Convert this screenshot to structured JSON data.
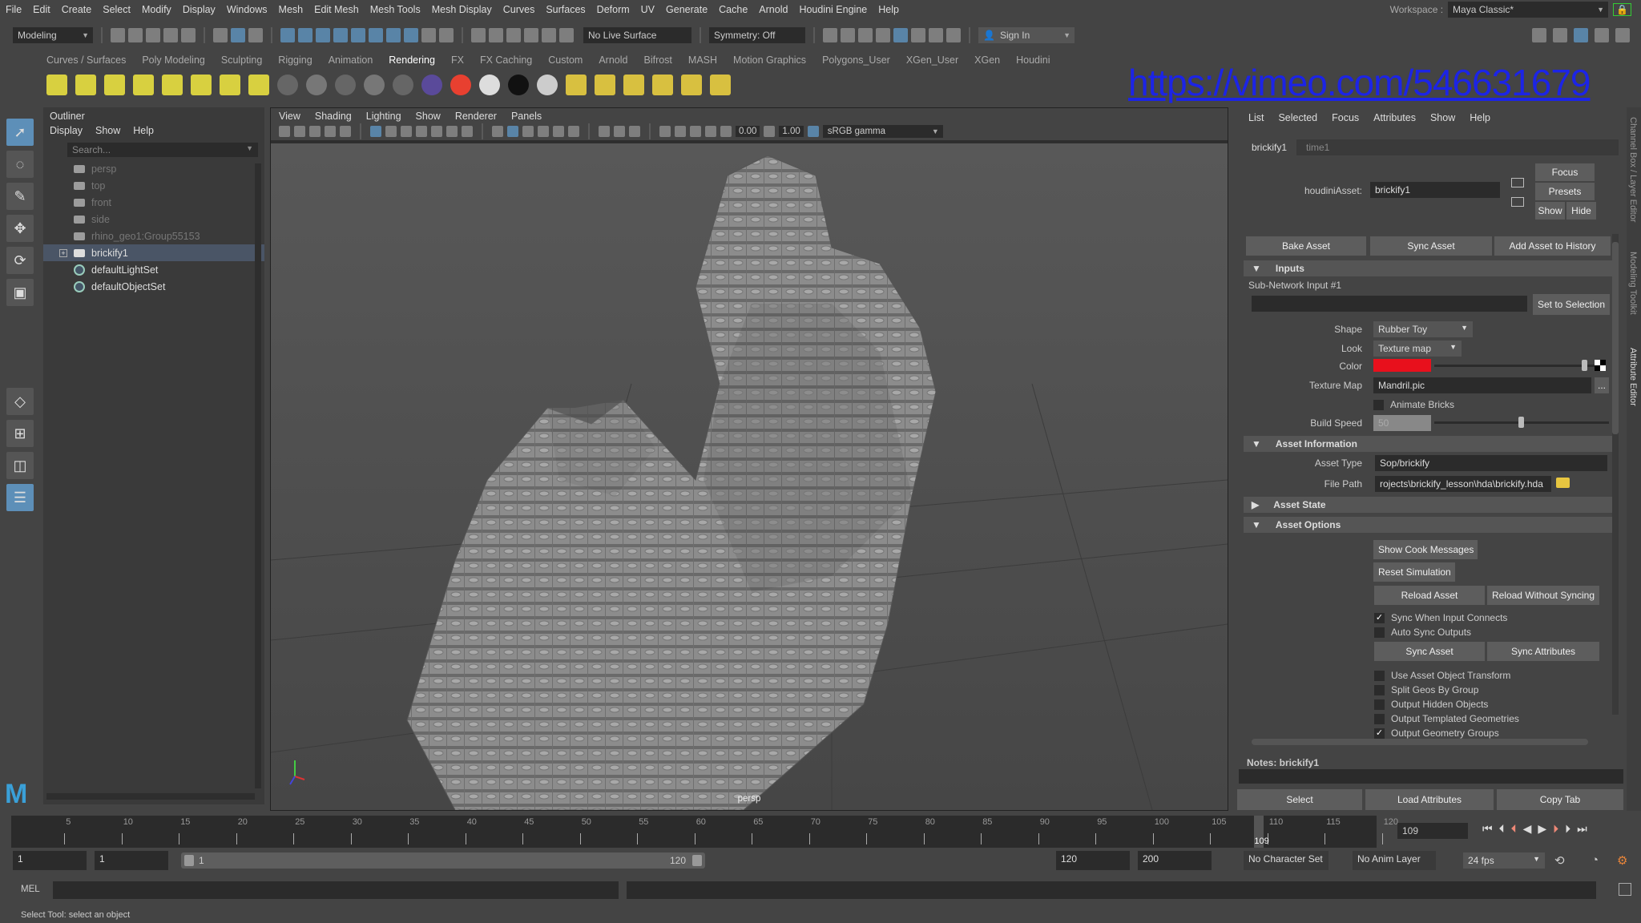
{
  "menubar": {
    "items": [
      "File",
      "Edit",
      "Create",
      "Select",
      "Modify",
      "Display",
      "Windows",
      "Mesh",
      "Edit Mesh",
      "Mesh Tools",
      "Mesh Display",
      "Curves",
      "Surfaces",
      "Deform",
      "UV",
      "Generate",
      "Cache",
      "Arnold",
      "Houdini Engine",
      "Help"
    ],
    "workspace_label": "Workspace :",
    "workspace_value": "Maya Classic*"
  },
  "statusline": {
    "mode": "Modeling",
    "live_surface": "No Live Surface",
    "symmetry": "Symmetry: Off",
    "sign_in": "Sign In"
  },
  "shelf": {
    "tabs": [
      "Curves / Surfaces",
      "Poly Modeling",
      "Sculpting",
      "Rigging",
      "Animation",
      "Rendering",
      "FX",
      "FX Caching",
      "Custom",
      "Arnold",
      "Bifrost",
      "MASH",
      "Motion Graphics",
      "Polygons_User",
      "XGen_User",
      "XGen",
      "Houdini"
    ],
    "active_tab": "Rendering",
    "icons": [
      "ambient-light",
      "directional-light",
      "point-light",
      "spot-light",
      "area-light",
      "volume-light",
      "camera-aim",
      "camera-aim-up",
      "blinn-sphere",
      "lambert-sphere",
      "phong-sphere",
      "phonge-sphere",
      "anisotropic-sphere",
      "layered-texture",
      "ramp-texture",
      "white-sphere",
      "black-sphere",
      "outline-sphere",
      "hypershade",
      "render-settings",
      "render-view",
      "ipr",
      "render-sequence",
      "render-setup"
    ]
  },
  "overlay_link": "https://vimeo.com/546631679",
  "outliner": {
    "title": "Outliner",
    "menus": [
      "Display",
      "Show",
      "Help"
    ],
    "search_placeholder": "Search...",
    "items": [
      {
        "label": "persp",
        "icon": "camera",
        "dim": true
      },
      {
        "label": "top",
        "icon": "camera",
        "dim": true
      },
      {
        "label": "front",
        "icon": "camera",
        "dim": true
      },
      {
        "label": "side",
        "icon": "camera",
        "dim": true
      },
      {
        "label": "rhino_geo1:Group55153",
        "icon": "group",
        "dim": true
      },
      {
        "label": "brickify1",
        "icon": "houdini-asset",
        "selected": true
      },
      {
        "label": "defaultLightSet",
        "icon": "set"
      },
      {
        "label": "defaultObjectSet",
        "icon": "set"
      }
    ]
  },
  "viewport": {
    "menus": [
      "View",
      "Shading",
      "Lighting",
      "Show",
      "Renderer",
      "Panels"
    ],
    "exposure": "0.00",
    "gamma": "1.00",
    "color_space": "sRGB gamma",
    "camera": "persp"
  },
  "attr_editor": {
    "menus": [
      "List",
      "Selected",
      "Focus",
      "Attributes",
      "Show",
      "Help"
    ],
    "tabs": [
      "brickify1",
      "time1"
    ],
    "asset_label": "houdiniAsset:",
    "asset_value": "brickify1",
    "focus": "Focus",
    "presets": "Presets",
    "show": "Show",
    "hide": "Hide",
    "bake": "Bake Asset",
    "sync": "Sync Asset",
    "add_history": "Add Asset to History",
    "inputs_header": "Inputs",
    "subnet_label": "Sub-Network Input #1",
    "set_selection": "Set to Selection",
    "shape_label": "Shape",
    "shape_value": "Rubber Toy",
    "look_label": "Look",
    "look_value": "Texture map",
    "color_label": "Color",
    "color_hex": "#e8101c",
    "texmap_label": "Texture Map",
    "texmap_value": "Mandril.pic",
    "browse": "...",
    "animate_bricks": "Animate Bricks",
    "build_speed_label": "Build Speed",
    "build_speed_value": "50",
    "build_speed_fraction": 0.5,
    "info_header": "Asset Information",
    "type_label": "Asset Type",
    "type_value": "Sop/brickify",
    "path_label": "File Path",
    "path_value": "rojects\\brickify_lesson\\hda\\brickify.hda",
    "state_header": "Asset State",
    "options_header": "Asset Options",
    "show_cook": "Show Cook Messages",
    "reset_sim": "Reset Simulation",
    "reload": "Reload Asset",
    "reload_nosync": "Reload Without Syncing",
    "sync_when": "Sync When Input Connects",
    "auto_sync": "Auto Sync Outputs",
    "sync_asset2": "Sync Asset",
    "sync_attrs": "Sync Attributes",
    "opts": [
      {
        "label": "Use Asset Object Transform",
        "checked": false
      },
      {
        "label": "Split Geos By Group",
        "checked": false
      },
      {
        "label": "Output Hidden Objects",
        "checked": false
      },
      {
        "label": "Output Templated Geometries",
        "checked": false
      },
      {
        "label": "Output Geometry Groups",
        "checked": true
      }
    ],
    "check_mark": "✓",
    "notes": "Notes:  brickify1",
    "select": "Select",
    "load_attrs": "Load Attributes",
    "copy_tab": "Copy Tab"
  },
  "side_tabs": [
    "Channel Box / Layer Editor",
    "Modeling Toolkit",
    "Attribute Editor"
  ],
  "timeline": {
    "ticks": [
      5,
      10,
      15,
      20,
      25,
      30,
      35,
      40,
      45,
      50,
      55,
      60,
      65,
      70,
      75,
      80,
      85,
      90,
      95,
      100,
      105,
      110,
      115,
      120
    ],
    "current": "109",
    "current_field": "109"
  },
  "range": {
    "start": "1",
    "anim_start": "1",
    "slider_start": "1",
    "slider_end": "120",
    "end": "120",
    "anim_end": "200",
    "char_set": "No Character Set",
    "anim_layer": "No Anim Layer",
    "fps": "24 fps"
  },
  "mel_label": "MEL",
  "help_line": "Select Tool: select an object"
}
